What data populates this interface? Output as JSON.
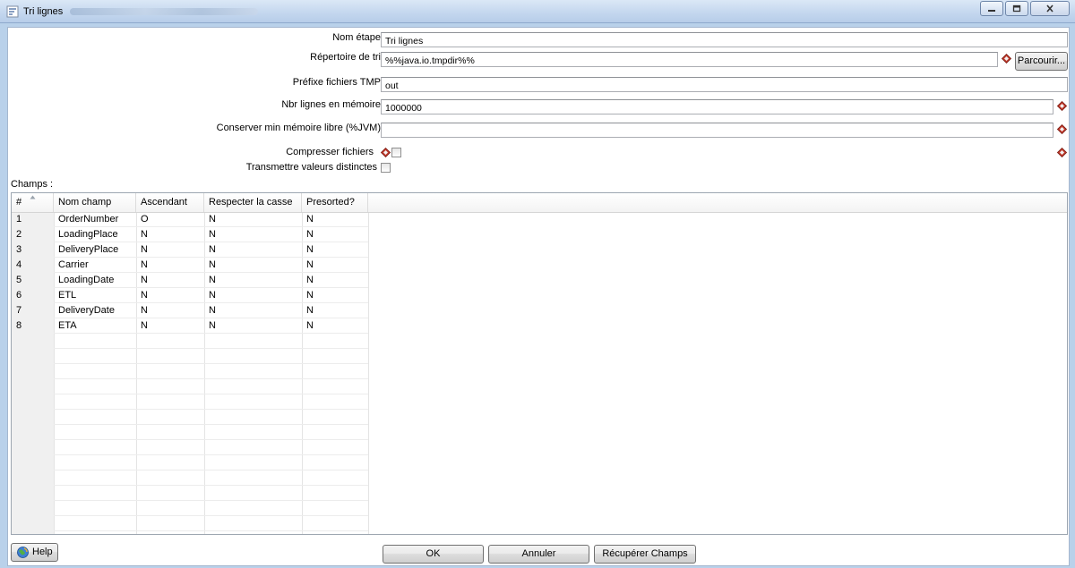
{
  "window": {
    "title": "Tri lignes"
  },
  "form": {
    "step_name_label": "Nom étape",
    "step_name_value": "Tri lignes",
    "sort_dir_label": "Répertoire de tri",
    "sort_dir_value": "%%java.io.tmpdir%%",
    "browse_label": "Parcourir...",
    "tmp_prefix_label": "Préfixe fichiers TMP",
    "tmp_prefix_value": "out",
    "rows_in_memory_label": "Nbr lignes en mémoire",
    "rows_in_memory_value": "1000000",
    "free_memory_label": "Conserver min mémoire libre (%JVM)",
    "free_memory_value": "",
    "compress_label": "Compresser fichiers",
    "compress_checked": false,
    "distinct_label": "Transmettre valeurs distinctes",
    "distinct_checked": false
  },
  "fields_section": {
    "label": "Champs :",
    "columns": [
      "#",
      "Nom champ",
      "Ascendant",
      "Respecter la casse",
      "Presorted?"
    ],
    "rows": [
      [
        "1",
        "OrderNumber",
        "O",
        "N",
        "N"
      ],
      [
        "2",
        "LoadingPlace",
        "N",
        "N",
        "N"
      ],
      [
        "3",
        "DeliveryPlace",
        "N",
        "N",
        "N"
      ],
      [
        "4",
        "Carrier",
        "N",
        "N",
        "N"
      ],
      [
        "5",
        "LoadingDate",
        "N",
        "N",
        "N"
      ],
      [
        "6",
        "ETL",
        "N",
        "N",
        "N"
      ],
      [
        "7",
        "DeliveryDate",
        "N",
        "N",
        "N"
      ],
      [
        "8",
        "ETA",
        "N",
        "N",
        "N"
      ]
    ]
  },
  "footer": {
    "help_label": "Help",
    "ok_label": "OK",
    "cancel_label": "Annuler",
    "get_fields_label": "Récupérer Champs"
  },
  "colors": {
    "window_frame": "#b9d1ea",
    "title_gradient_top": "#dbe8f6",
    "variable_icon": "#c0392b"
  },
  "icons": {
    "app": "sort-rows-icon",
    "variable": "variable-diamond-icon",
    "help": "help-globe-icon"
  }
}
